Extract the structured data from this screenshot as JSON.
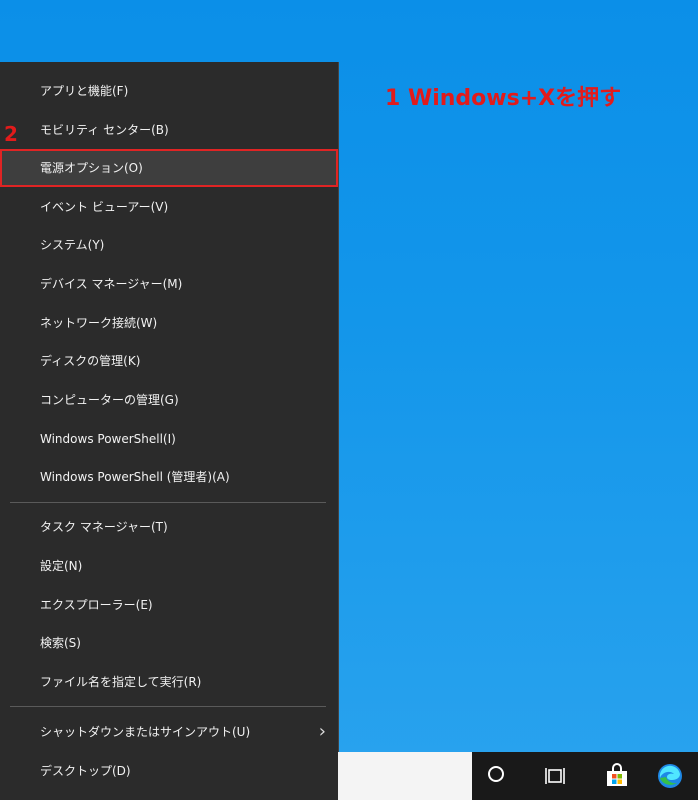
{
  "menu": {
    "items": [
      {
        "label": "アプリと機能(F)"
      },
      {
        "label": "モビリティ センター(B)"
      },
      {
        "label": "電源オプション(O)"
      },
      {
        "label": "イベント ビューアー(V)"
      },
      {
        "label": "システム(Y)"
      },
      {
        "label": "デバイス マネージャー(M)"
      },
      {
        "label": "ネットワーク接続(W)"
      },
      {
        "label": "ディスクの管理(K)"
      },
      {
        "label": "コンピューターの管理(G)"
      },
      {
        "label": "Windows PowerShell(I)"
      },
      {
        "label": "Windows PowerShell (管理者)(A)"
      },
      {
        "label": "タスク マネージャー(T)"
      },
      {
        "label": "設定(N)"
      },
      {
        "label": "エクスプローラー(E)"
      },
      {
        "label": "検索(S)"
      },
      {
        "label": "ファイル名を指定して実行(R)"
      },
      {
        "label": "シャットダウンまたはサインアウト(U)"
      },
      {
        "label": "デスクトップ(D)"
      }
    ],
    "submenu_chevron": "›"
  },
  "annotations": {
    "step1": "1 Windows+Xを押す",
    "step2": "2"
  },
  "colors": {
    "annotation": "#e21b1b",
    "menu_bg": "#2b2b2b",
    "desktop": "#0b8fe8"
  }
}
